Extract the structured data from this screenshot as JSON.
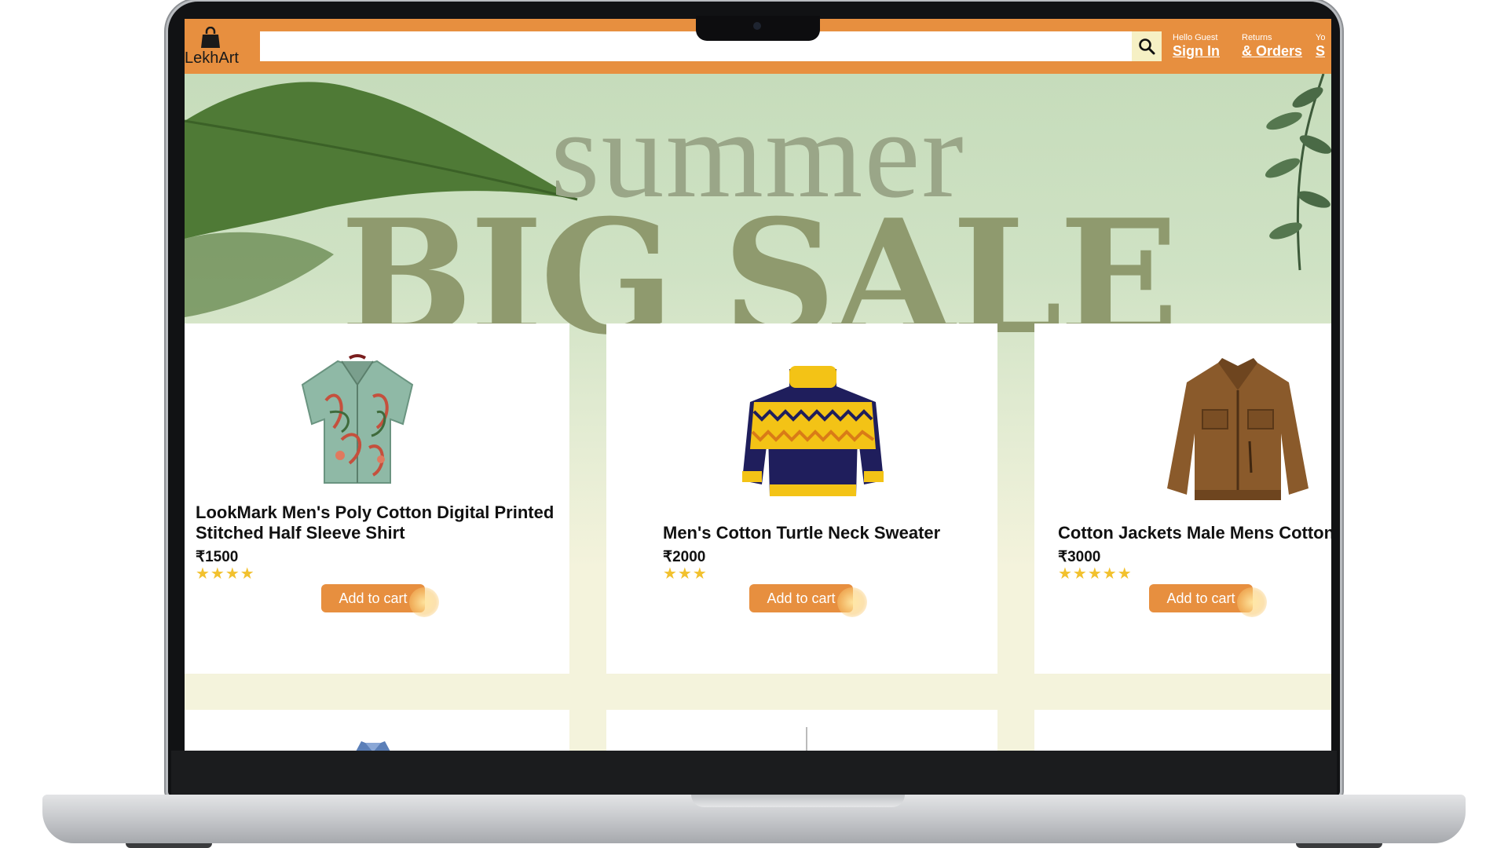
{
  "navbar": {
    "logo_text": "LekhArt",
    "search": {
      "value": "",
      "placeholder": ""
    },
    "signin": {
      "small": "Hello Guest",
      "big": "Sign In"
    },
    "orders": {
      "small": "Returns",
      "big": "& Orders"
    },
    "cart": {
      "small": "Yo",
      "big": "S"
    }
  },
  "banner": {
    "line1": "summer",
    "line2": "BIG SALE"
  },
  "products": [
    {
      "title_line1": "LookMark Men's Poly Cotton Digital Printed",
      "title_line2": "Stitched Half Sleeve Shirt",
      "price": "₹1500",
      "rating": 4,
      "stars": "★★★★",
      "button": "Add to cart",
      "image": "floral-shirt"
    },
    {
      "title_line1": "Men's Cotton Turtle Neck Sweater",
      "title_line2": "",
      "price": "₹2000",
      "rating": 3,
      "stars": "★★★",
      "button": "Add to cart",
      "image": "turtle-neck-sweater"
    },
    {
      "title_line1": "Cotton Jackets Male Mens Cotton",
      "title_line2": "",
      "price": "₹3000",
      "rating": 5,
      "stars": "★★★★★",
      "button": "Add to cart",
      "image": "brown-jacket"
    }
  ],
  "colors": {
    "navbar": "#e78f3f",
    "button": "#e78f3f",
    "star": "#f2c12e",
    "page_bg": "#f4f3dc"
  }
}
